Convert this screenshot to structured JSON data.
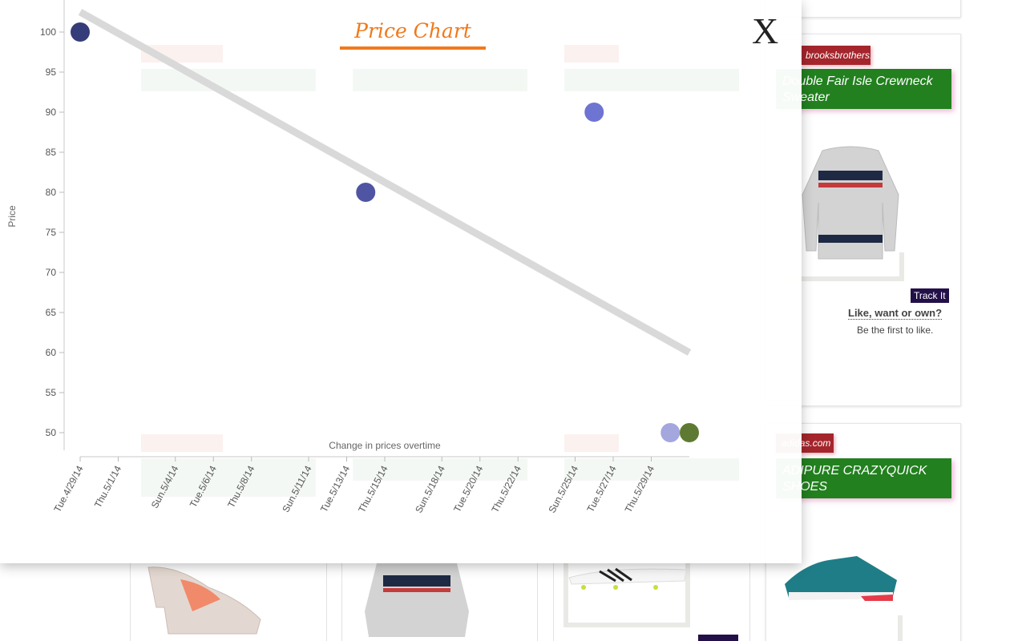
{
  "overlay": {
    "title": "Price Chart",
    "close_label": "X"
  },
  "chart_data": {
    "type": "scatter",
    "title": "Price Chart",
    "xlabel": "Change in prices overtime",
    "ylabel": "Price",
    "ylim": [
      50,
      100
    ],
    "y_ticks": [
      100,
      95,
      90,
      85,
      80,
      75,
      70,
      65,
      60,
      55,
      50
    ],
    "x_ticks": [
      "Tue.4/29/14",
      "Thu.5/1/14",
      "Sun.5/4/14",
      "Tue.5/6/14",
      "Thu.5/8/14",
      "Sun.5/11/14",
      "Tue.5/13/14",
      "Thu.5/15/14",
      "Sun.5/18/14",
      "Tue.5/20/14",
      "Thu.5/22/14",
      "Sun.5/25/14",
      "Tue.5/27/14",
      "Thu.5/29/14"
    ],
    "points": [
      {
        "x": "2014-04-29",
        "y": 100,
        "color": "#353c7a"
      },
      {
        "x": "2014-05-14",
        "y": 80,
        "color": "#4f55a3"
      },
      {
        "x": "2014-05-26",
        "y": 90,
        "color": "#6e74d2"
      },
      {
        "x": "2014-05-30",
        "y": 50,
        "color": "#a4a6de"
      },
      {
        "x": "2014-05-31",
        "y": 50,
        "color": "#5e7a32"
      }
    ],
    "trend_line": {
      "from": {
        "x": "2014-04-29",
        "y": 102.5
      },
      "to": {
        "x": "2014-05-31",
        "y": 60
      },
      "color": "#d9d9d9"
    },
    "grid": false
  },
  "right_cards": [
    {
      "store": "brooksbrothers.com",
      "title": "Double Fair Isle Crewneck Sweater",
      "track_label": "Track It",
      "like_label": "Like, want or own?",
      "like_sub": "Be the first to like."
    },
    {
      "store": "adidas.com",
      "title": "ADIPURE CRAZYQUICK SHOES"
    }
  ],
  "colors": {
    "accent_orange": "#f07a1c",
    "store_tag_red": "#a4262c",
    "title_green": "#22801f",
    "track_button": "#231048"
  }
}
